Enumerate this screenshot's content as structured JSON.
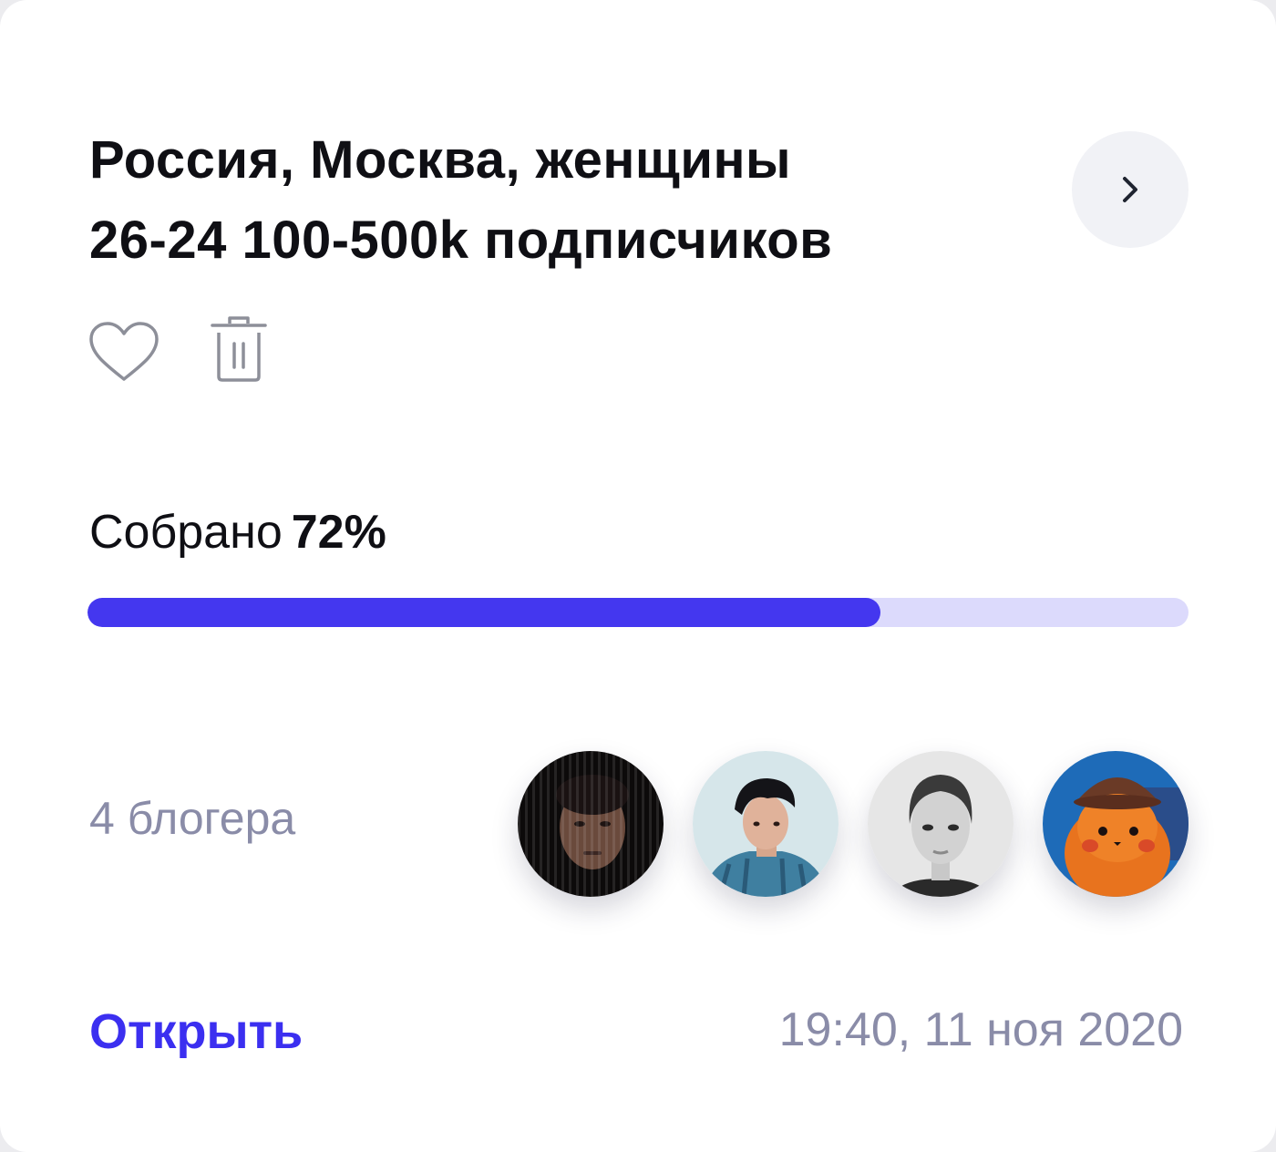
{
  "card": {
    "title_line1": "Россия, Москва, женщины",
    "title_line2": "26-24 100-500k подписчиков"
  },
  "icons": {
    "next": "chevron-right-icon",
    "favorite": "heart-icon",
    "delete": "trash-icon"
  },
  "progress": {
    "label": "Собрано",
    "percent_text": "72%",
    "fraction": 0.72,
    "fill_color": "#4437ef",
    "track_color": "#dcdafc"
  },
  "bloggers": {
    "count_text": "4 блогера",
    "avatars": [
      "blogger-avatar-1",
      "blogger-avatar-2",
      "blogger-avatar-3",
      "blogger-avatar-4"
    ]
  },
  "footer": {
    "open_label": "Открыть",
    "timestamp": "19:40, 11 ноя 2020",
    "link_color": "#3b2ff0",
    "muted_color": "#8a8ca8"
  }
}
